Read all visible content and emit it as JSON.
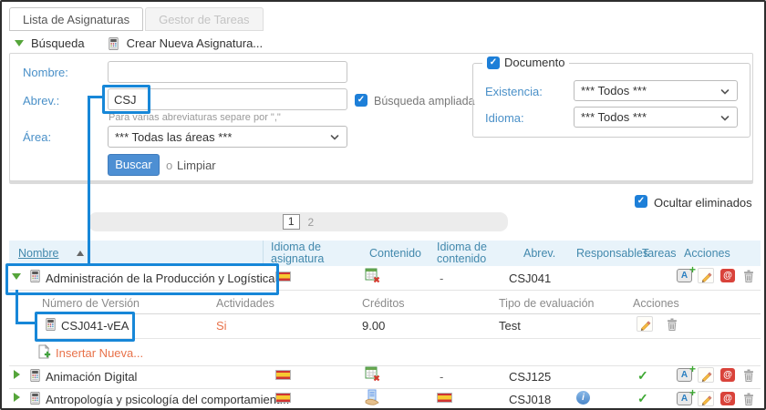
{
  "icons": {
    "check": "✓",
    "info_letter": "i",
    "at": "@",
    "translate_letter": "A",
    "plus": "+"
  },
  "colors": {
    "annotation_blue": "#1787d8",
    "checkbox_blue": "#1d7fd8",
    "button_blue": "#4d8fd3",
    "label_blue": "#4a90c8",
    "header_text_blue": "#4389ad",
    "header_bg": "#e8f3fa",
    "expand_green": "#55a53a",
    "accent_orange": "#e8724a"
  },
  "tabs": {
    "subjects_label": "Lista de Asignaturas",
    "tasks_label": "Gestor de Tareas"
  },
  "toolbar": {
    "search_toggle_label": "Búsqueda",
    "create_new_label": "Crear Nueva Asignatura..."
  },
  "search": {
    "nombre_label": "Nombre:",
    "nombre_value": "",
    "abrev_label": "Abrev.:",
    "abrev_value": "CSJ",
    "abrev_hint": "Para varias abreviaturas separe por \",\"",
    "area_label": "Área:",
    "area_value": "*** Todas las áreas ***",
    "buscar_label": "Buscar",
    "or_label": "o",
    "limpiar_label": "Limpiar",
    "ampliada_label": "Búsqueda ampliada",
    "documento_legend": "Documento",
    "existencia_label": "Existencia:",
    "existencia_value": "*** Todos ***",
    "idioma_label": "Idioma:",
    "idioma_value": "*** Todos ***"
  },
  "results_bar": {
    "hide_deleted_label": "Ocultar eliminados",
    "page_1": "1",
    "page_2": "2"
  },
  "table": {
    "headers": {
      "nombre": "Nombre",
      "idioma_asignatura": "Idioma de asignatura",
      "contenido": "Contenido",
      "idioma_contenido": "Idioma de contenido",
      "abrev": "Abrev.",
      "responsables": "Responsables",
      "tareas": "Tareas",
      "acciones": "Acciones"
    },
    "rows": [
      {
        "name": "Administración de la Producción y Logística",
        "idioma_contenido": "-",
        "abrev": "CSJ041"
      },
      {
        "name": "Animación Digital",
        "idioma_contenido": "-",
        "abrev": "CSJ125"
      },
      {
        "name": "Antropología y psicología del comportamient...",
        "abrev": "CSJ018"
      }
    ]
  },
  "version_table": {
    "headers": {
      "version": "Número de Versión",
      "actividades": "Actividades",
      "creditos": "Créditos",
      "tipo": "Tipo de evaluación",
      "acciones": "Acciones"
    },
    "row": {
      "version": "CSJ041-vEA",
      "actividades": "Si",
      "creditos": "9.00",
      "tipo": "Test"
    },
    "insert_new_label": "Insertar Nueva..."
  }
}
